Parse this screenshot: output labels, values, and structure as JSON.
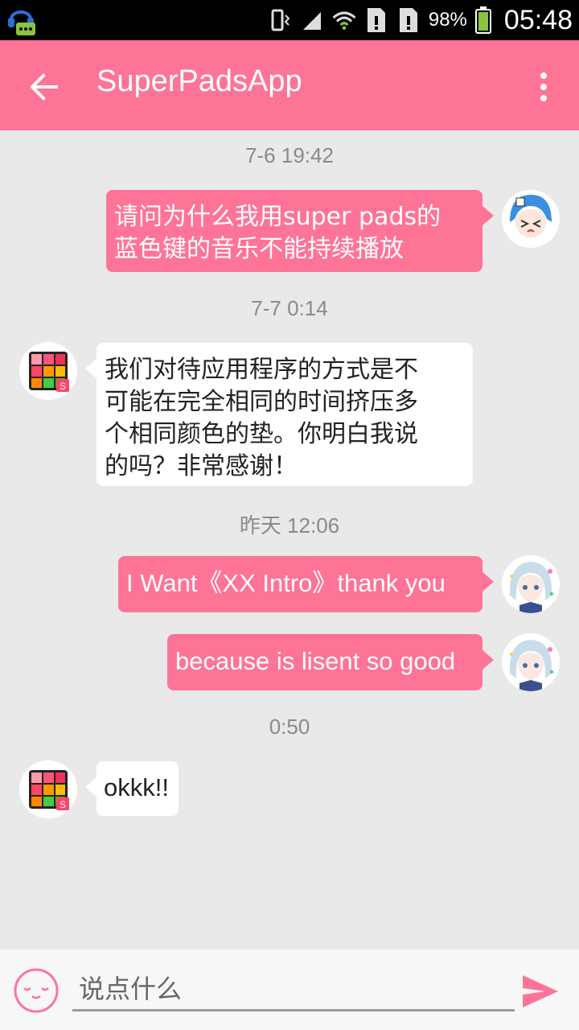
{
  "status_bar": {
    "battery_percent": "98%",
    "time": "05:48"
  },
  "app_bar": {
    "title": "SuperPadsApp",
    "back_icon": "arrow-left-icon",
    "menu_icon": "more-vert-icon"
  },
  "conversation": [
    {
      "type": "timestamp",
      "text": "7-6 19:42"
    },
    {
      "type": "message",
      "side": "me",
      "lines": [
        "请问为什么我用super pads的",
        "蓝色键的音乐不能持续播放"
      ]
    },
    {
      "type": "timestamp",
      "text": "7-7 0:14"
    },
    {
      "type": "message",
      "side": "them",
      "lines": [
        "我们对待应用程序的方式是不",
        "可能在完全相同的时间挤压多",
        "个相同颜色的垫。你明白我说",
        "的吗？非常感谢！"
      ]
    },
    {
      "type": "timestamp",
      "text": "昨天 12:06"
    },
    {
      "type": "message",
      "side": "me",
      "lines": [
        "I Want《XX Intro》thank you"
      ]
    },
    {
      "type": "message",
      "side": "me",
      "lines": [
        "because is lisent so good"
      ]
    },
    {
      "type": "timestamp",
      "text": "0:50"
    },
    {
      "type": "message",
      "side": "them",
      "lines": [
        "okkk!!"
      ]
    }
  ],
  "input_bar": {
    "placeholder": "说点什么",
    "emoji_icon": "emoji-face-icon",
    "send_icon": "send-icon"
  },
  "colors": {
    "accent": "#fd7497",
    "background": "#e9e9e9"
  }
}
